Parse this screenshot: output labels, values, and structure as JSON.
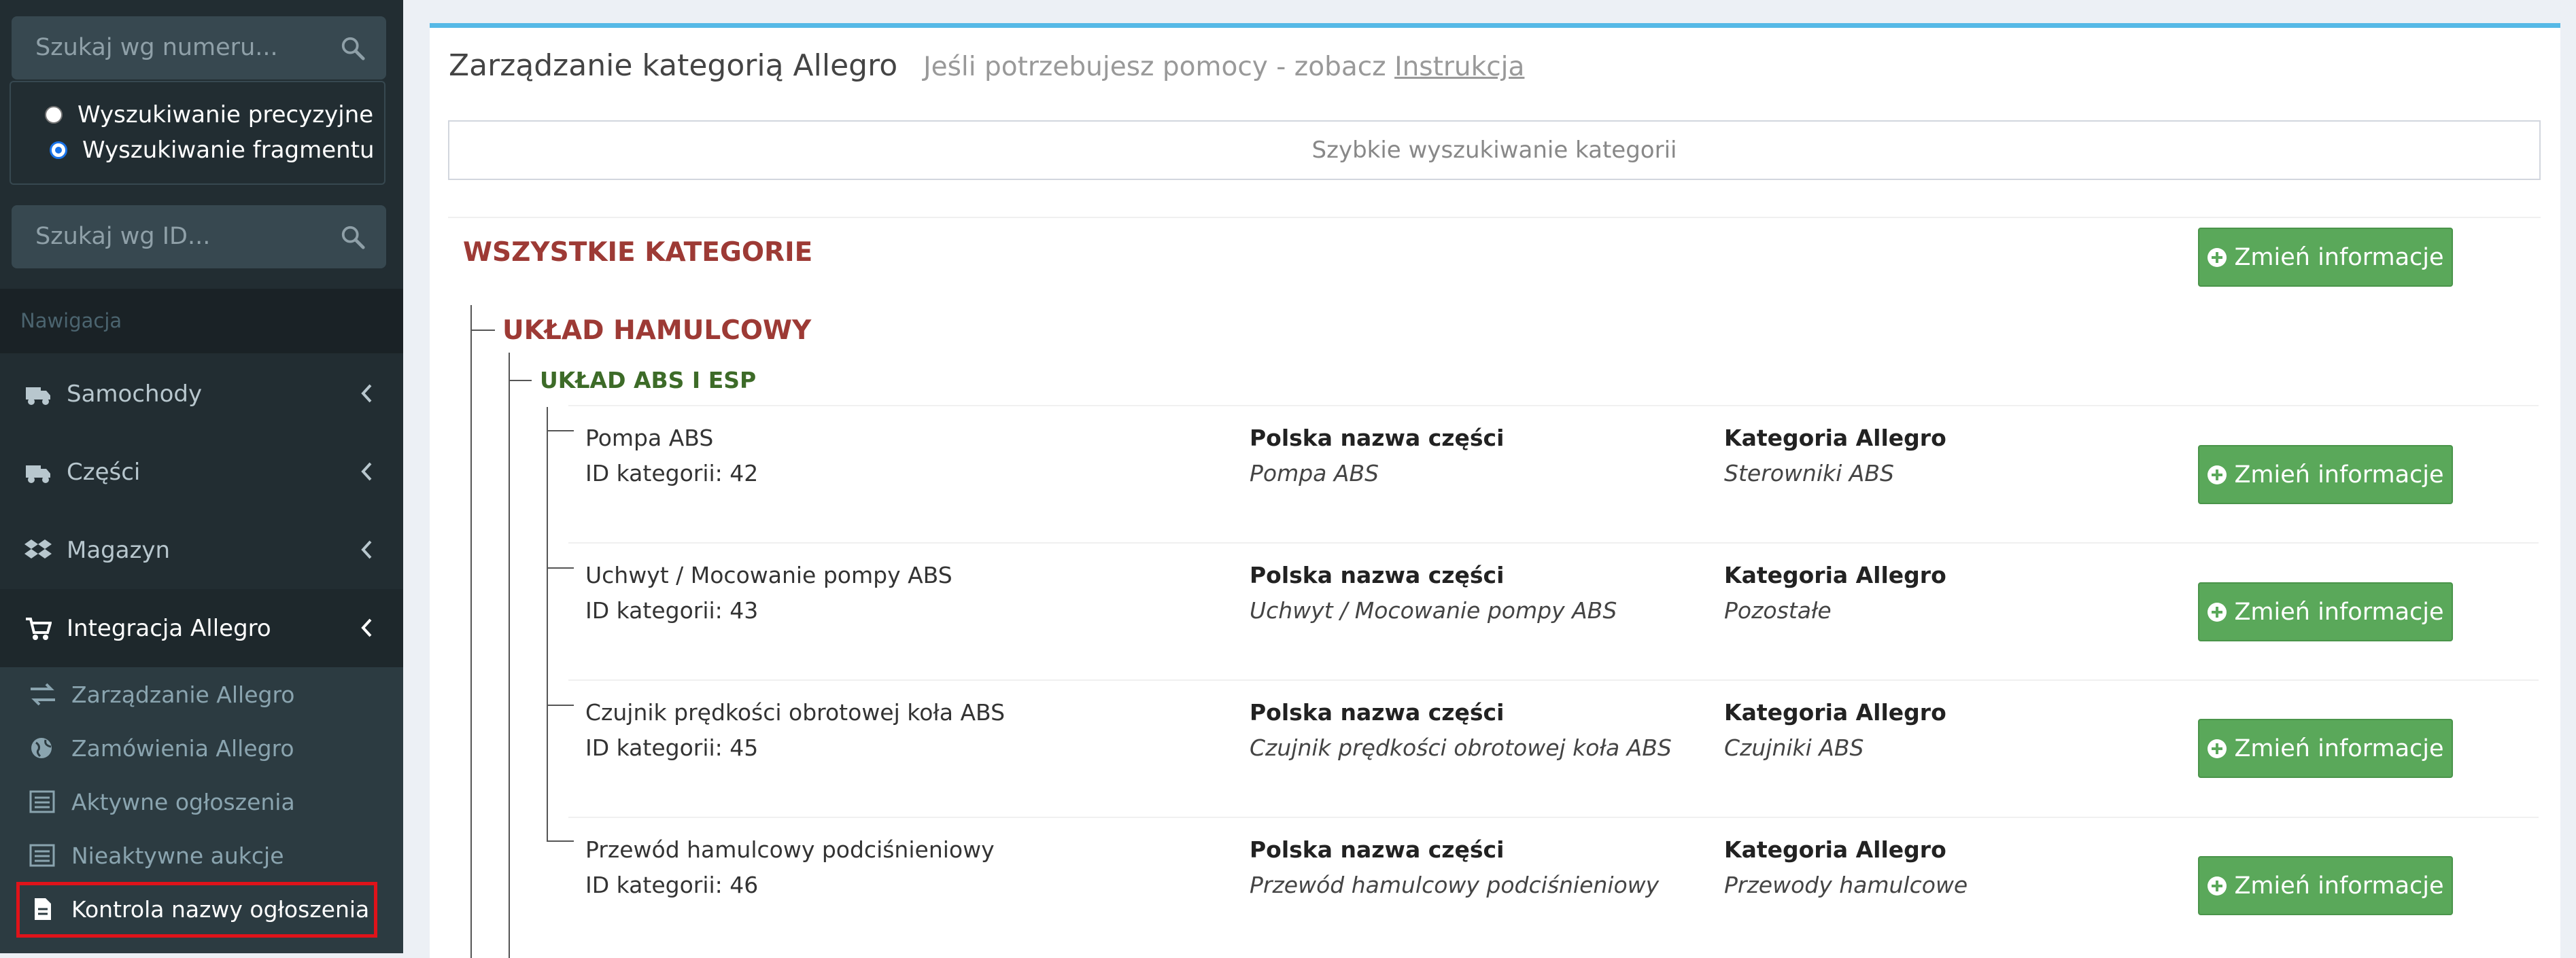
{
  "sidebar": {
    "search_number_placeholder": "Szukaj wg numeru...",
    "radio_precise": "Wyszukiwanie precyzyjne",
    "radio_fragment": "Wyszukiwanie fragmentu",
    "search_id_placeholder": "Szukaj wg ID...",
    "nav_header": "Nawigacja",
    "menu": [
      {
        "label": "Samochody",
        "icon": "truck-icon"
      },
      {
        "label": "Części",
        "icon": "truck-icon"
      },
      {
        "label": "Magazyn",
        "icon": "dropbox-icon"
      },
      {
        "label": "Integracja Allegro",
        "icon": "cart-icon"
      }
    ],
    "submenu": [
      {
        "label": "Zarządzanie Allegro",
        "icon": "exchange-icon"
      },
      {
        "label": "Zamówienia Allegro",
        "icon": "globe-icon"
      },
      {
        "label": "Aktywne ogłoszenia",
        "icon": "list-icon"
      },
      {
        "label": "Nieaktywne aukcje",
        "icon": "list-icon"
      },
      {
        "label": "Kontrola nazwy ogłoszenia",
        "icon": "file-icon"
      }
    ]
  },
  "main": {
    "title": "Zarządzanie kategorią Allegro",
    "help_text": "Jeśli potrzebujesz pomocy - zobacz",
    "help_link": "Instrukcja",
    "quick_search": "Szybkie wyszukiwanie kategorii",
    "all_categories": "WSZYSTKIE KATEGORIE",
    "category_level1": "UKŁAD HAMULCOWY",
    "category_level2": "UKŁAD ABS I ESP",
    "button_label": "Zmień informacje",
    "col_polish_label": "Polska nazwa części",
    "col_allegro_label": "Kategoria Allegro",
    "rows": [
      {
        "name": "Pompa ABS",
        "id_text": "ID kategorii: 42",
        "polish": "Pompa ABS",
        "allegro": "Sterowniki ABS"
      },
      {
        "name": "Uchwyt / Mocowanie pompy ABS",
        "id_text": "ID kategorii: 43",
        "polish": "Uchwyt / Mocowanie pompy ABS",
        "allegro": "Pozostałe"
      },
      {
        "name": "Czujnik prędkości obrotowej koła ABS",
        "id_text": "ID kategorii: 45",
        "polish": "Czujnik prędkości obrotowej koła ABS",
        "allegro": "Czujniki ABS"
      },
      {
        "name": "Przewód hamulcowy podciśnieniowy",
        "id_text": "ID kategorii: 46",
        "polish": "Przewód hamulcowy podciśnieniowy",
        "allegro": "Przewody hamulcowe"
      }
    ]
  },
  "colors": {
    "sidebar_bg": "#222d32",
    "accent_red": "#9d3a35",
    "accent_green": "#3d6b28",
    "button_green": "#5aa85a",
    "panel_top": "#56b9e6",
    "highlight_border": "#e0131a"
  }
}
